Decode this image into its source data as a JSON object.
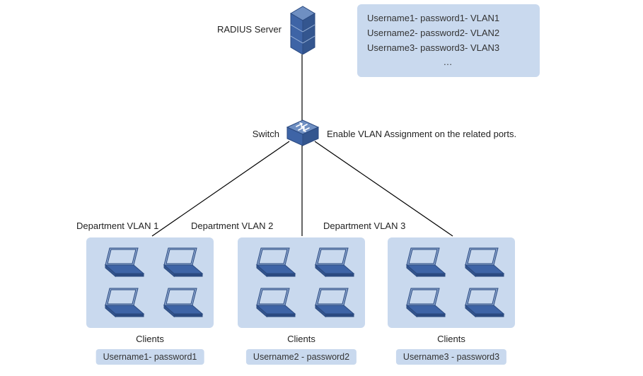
{
  "server_label": "RADIUS Server",
  "switch_label": "Switch",
  "switch_note": "Enable VLAN Assignment on the related ports.",
  "mappings": {
    "line1": "Username1- password1- VLAN1",
    "line2": "Username2- password2- VLAN2",
    "line3": "Username3- password3- VLAN3",
    "more": "…"
  },
  "dept": {
    "d1": "Department VLAN 1",
    "d2": "Department VLAN 2",
    "d3": "Department VLAN 3"
  },
  "clients_label": "Clients",
  "cred": {
    "c1": "Username1- password1",
    "c2": "Username2 - password2",
    "c3": "Username3 - password3"
  },
  "colors": {
    "accent": "#3e64a6",
    "panel": "#c9d9ee"
  }
}
